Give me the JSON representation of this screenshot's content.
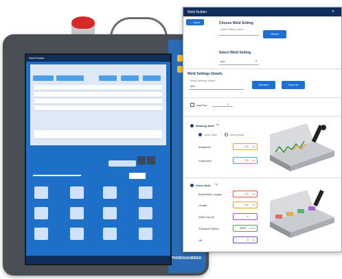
{
  "dialog": {
    "title": "Weld Builder",
    "back_label": "Back",
    "choose_title": "Choose Weld Setting",
    "weld_setting_placeholder": "Weld Setting name",
    "select_label": "Select",
    "select_weld_title": "Select Weld Setting",
    "select_value": "test",
    "details_title": "Weld Settings Details",
    "details_name_label": "Weld Settings Name",
    "details_name_value": "test",
    "rename_label": "Rename",
    "save_label": "Save As",
    "add_run_label": "Add Run",
    "add_run_value": "1",
    "weaving_title": "Weaving Weld",
    "stitch_title": "Close Weld",
    "weave_option_1": "Weld Style",
    "weave_option_2": "Weld Wave",
    "amplitude_label": "Amplitude",
    "amplitude_value": "2.1",
    "frequency_label": "Frequency",
    "frequency_value": "3.1",
    "bead_label": "Bead/Stitch Length",
    "bead_value": "2.1",
    "length_label": "Length",
    "length_value": "0.1",
    "count_label": "Weld Counts",
    "count_value": "1",
    "speed_label": "Transport Speed",
    "speed_value": "3000",
    "lift_label": "Lift",
    "lift_value": "2",
    "unit_mm": "mm",
    "unit_rate": "mm/min"
  },
  "pendant": {
    "screen_title": "Weld Builder",
    "brand": "THOROUGHBRED",
    "colors": {
      "estop": "#d62a2a",
      "accent": "#1e6fc7",
      "header": "#0f2e5a"
    }
  },
  "colors": {
    "amplitude_border": "#e8a21b",
    "frequency_border": "#3aa0e0",
    "bead_border": "#e05050",
    "length_border": "#e8a21b",
    "count_border": "#9b4ad0",
    "speed_border": "#3aa95a",
    "lift_border": "#7a40c0"
  }
}
